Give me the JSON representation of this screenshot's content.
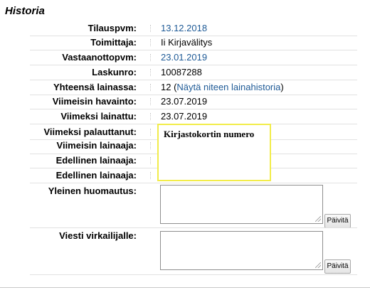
{
  "section_title": "Historia",
  "rows": {
    "tilauspvm": {
      "label": "Tilauspvm:",
      "value": "13.12.2018"
    },
    "toimittaja": {
      "label": "Toimittaja:",
      "value": "Ii Kirjavälitys"
    },
    "vastaanottopvm": {
      "label": "Vastaanottopvm:",
      "value": "23.01.2019"
    },
    "laskunro": {
      "label": "Laskunro:",
      "value": "10087288"
    },
    "yhteensa": {
      "label": "Yhteensä lainassa:",
      "value_prefix": "12 (",
      "link": "Näytä niteen lainahistoria",
      "value_suffix": ")"
    },
    "viimeisin_havainto": {
      "label": "Viimeisin havainto:",
      "value": "23.07.2019"
    },
    "viimeksi_lainattu": {
      "label": "Viimeksi lainattu:",
      "value": "23.07.2019"
    },
    "viimeksi_palauttanut": {
      "label": "Viimeksi palauttanut:"
    },
    "viimeisin_lainaaja": {
      "label": "Viimeisin lainaaja:"
    },
    "edellinen_lainaaja_1": {
      "label": "Edellinen lainaaja:"
    },
    "edellinen_lainaaja_2": {
      "label": "Edellinen lainaaja:"
    }
  },
  "popup_text": "Kirjastokortin numero",
  "notes": {
    "yleinen": {
      "label": "Yleinen huomautus:",
      "value": "",
      "button": "Päivitä"
    },
    "viesti": {
      "label": "Viesti virkailijalle:",
      "value": "",
      "button": "Päivitä"
    }
  },
  "colors": {
    "link": "#1e5a96",
    "popup_border": "#f2ec4a"
  }
}
